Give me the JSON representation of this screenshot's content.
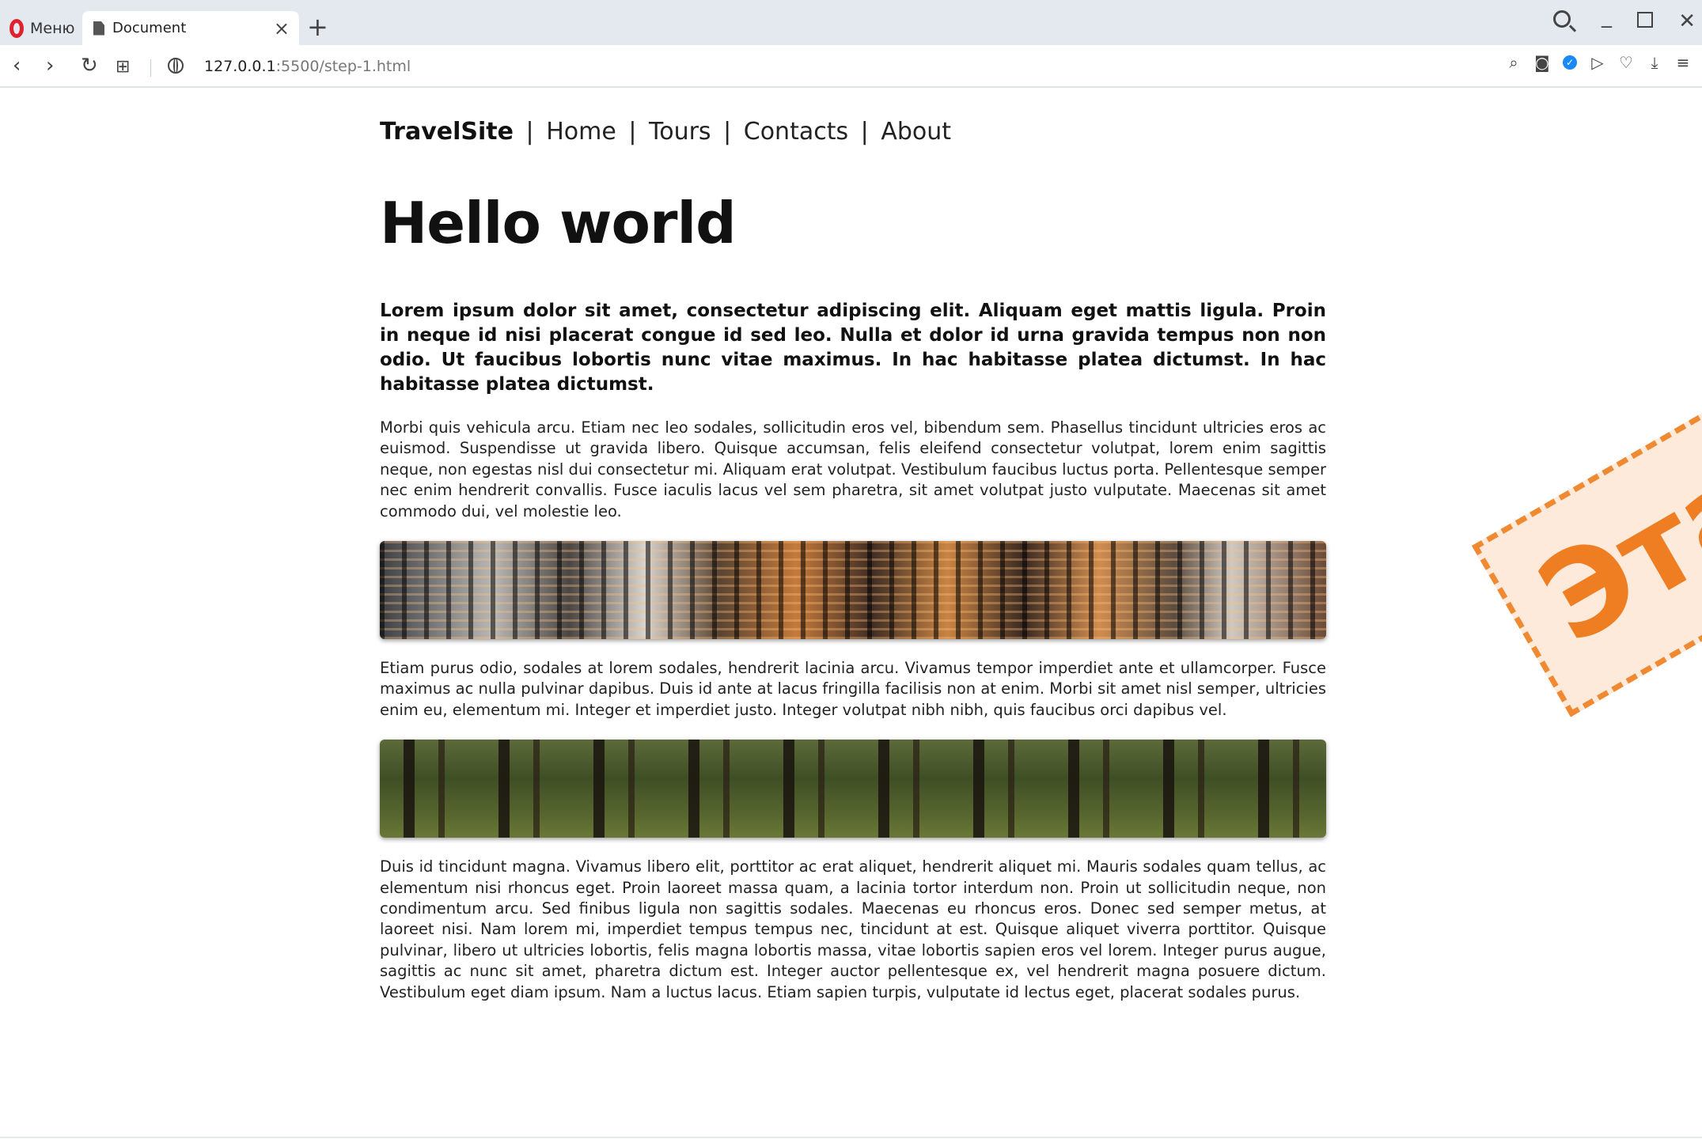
{
  "browser": {
    "menu_label": "Меню",
    "tab_title": "Document",
    "url_host": "127.0.0.1",
    "url_rest": ":5500/step-1.html",
    "icons": [
      "opera-logo-icon",
      "document-icon",
      "close-icon",
      "plus-icon",
      "search-icon",
      "minimize-icon",
      "maximize-icon",
      "window-close-icon",
      "back-icon",
      "forward-icon",
      "reload-icon",
      "tab-grid-icon",
      "globe-icon",
      "snapshot-icon",
      "camera-icon",
      "vpn-icon",
      "send-icon",
      "heart-icon",
      "download-icon",
      "easy-setup-icon"
    ]
  },
  "page": {
    "nav": {
      "brand": "TravelSite",
      "separator": "|",
      "links": [
        "Home",
        "Tours",
        "Contacts",
        "About"
      ]
    },
    "heading": "Hello world",
    "lead": "Lorem ipsum dolor sit amet, consectetur adipiscing elit. Aliquam eget mattis ligula. Proin in neque id nisi placerat congue id sed leo. Nulla et dolor id urna gravida tempus non non odio. Ut faucibus lobortis nunc vitae maximus. In hac habitasse platea dictumst. In hac habitasse platea dictumst.",
    "paragraph1": "Morbi quis vehicula arcu. Etiam nec leo sodales, sollicitudin eros vel, bibendum sem. Phasellus tincidunt ultricies eros ac euismod. Suspendisse ut gravida libero. Quisque accumsan, felis eleifend consectetur volutpat, lorem enim sagittis neque, non egestas nisl dui consectetur mi. Aliquam erat volutpat. Vestibulum faucibus luctus porta. Pellentesque semper nec enim hendrerit convallis. Fusce iaculis lacus vel sem pharetra, sit amet volutpat justo vulputate. Maecenas sit amet commodo dui, vel molestie leo.",
    "paragraph2": "Etiam purus odio, sodales at lorem sodales, hendrerit lacinia arcu. Vivamus tempor imperdiet ante et ullamcorper. Fusce maximus ac nulla pulvinar dapibus. Duis id ante at lacus fringilla facilisis non at enim. Morbi sit amet nisl semper, ultricies enim eu, elementum mi. Integer et imperdiet justo. Integer volutpat nibh nibh, quis faucibus orci dapibus vel.",
    "paragraph3": "Duis id tincidunt magna. Vivamus libero elit, porttitor ac erat aliquet, hendrerit aliquet mi. Mauris sodales quam tellus, ac elementum nisi rhoncus eget. Proin laoreet massa quam, a lacinia tortor interdum non. Proin ut sollicitudin neque, non condimentum arcu. Sed finibus ligula non sagittis sodales. Maecenas eu rhoncus eros. Donec sed semper metus, at laoreet nisi. Nam lorem mi, imperdiet tempus tempus nec, tincidunt at est. Quisque aliquet viverra porttitor. Quisque pulvinar, libero ut ultricies lobortis, felis magna lobortis massa, vitae lobortis sapien eros vel lorem. Integer purus augue, sagittis ac nunc sit amet, pharetra dictum est. Integer auctor pellentesque ex, vel hendrerit magna posuere dictum. Vestibulum eget diam ipsum. Nam a luctus lacus. Etiam sapien turpis, vulputate id lectus eget, placerat sodales purus."
  },
  "stamp": {
    "text": "Этап"
  },
  "colors": {
    "accent": "#ef7d22",
    "opera_red": "#e0212e",
    "vpn_blue": "#1a88f5"
  }
}
